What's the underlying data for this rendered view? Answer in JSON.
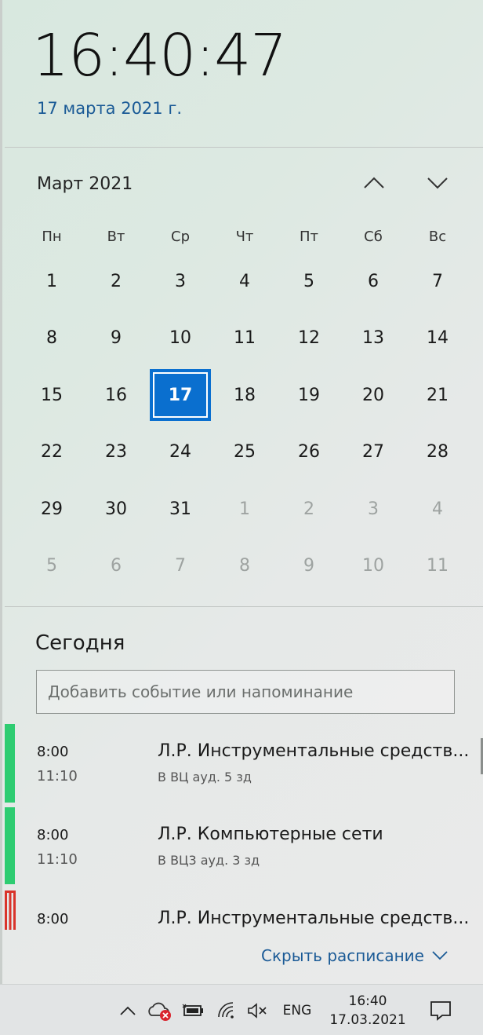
{
  "clock": {
    "time": "16:40:47",
    "date": "17 марта 2021 г."
  },
  "calendar": {
    "month_title": "Март 2021",
    "weekdays": [
      "Пн",
      "Вт",
      "Ср",
      "Чт",
      "Пт",
      "Сб",
      "Вс"
    ],
    "days": [
      {
        "d": "1"
      },
      {
        "d": "2"
      },
      {
        "d": "3"
      },
      {
        "d": "4"
      },
      {
        "d": "5"
      },
      {
        "d": "6"
      },
      {
        "d": "7"
      },
      {
        "d": "8"
      },
      {
        "d": "9"
      },
      {
        "d": "10"
      },
      {
        "d": "11"
      },
      {
        "d": "12"
      },
      {
        "d": "13"
      },
      {
        "d": "14"
      },
      {
        "d": "15"
      },
      {
        "d": "16"
      },
      {
        "d": "17",
        "today": true
      },
      {
        "d": "18"
      },
      {
        "d": "19"
      },
      {
        "d": "20"
      },
      {
        "d": "21"
      },
      {
        "d": "22"
      },
      {
        "d": "23"
      },
      {
        "d": "24"
      },
      {
        "d": "25"
      },
      {
        "d": "26"
      },
      {
        "d": "27"
      },
      {
        "d": "28"
      },
      {
        "d": "29"
      },
      {
        "d": "30"
      },
      {
        "d": "31"
      },
      {
        "d": "1",
        "other": true
      },
      {
        "d": "2",
        "other": true
      },
      {
        "d": "3",
        "other": true
      },
      {
        "d": "4",
        "other": true
      },
      {
        "d": "5",
        "other": true
      },
      {
        "d": "6",
        "other": true
      },
      {
        "d": "7",
        "other": true
      },
      {
        "d": "8",
        "other": true
      },
      {
        "d": "9",
        "other": true
      },
      {
        "d": "10",
        "other": true
      },
      {
        "d": "11",
        "other": true
      }
    ],
    "prev_icon": "chevron-up-icon",
    "next_icon": "chevron-down-icon"
  },
  "agenda": {
    "title": "Сегодня",
    "add_placeholder": "Добавить событие или напоминание",
    "events": [
      {
        "start": "8:00",
        "end": "11:10",
        "title": "Л.Р. Инструментальные средств...",
        "location": "В ВЦ ауд. 5 зд",
        "color": "#2ecc71"
      },
      {
        "start": "8:00",
        "end": "11:10",
        "title": "Л.Р. Компьютерные сети",
        "location": "В ВЦ3 ауд. 3 зд",
        "color": "#2ecc71"
      },
      {
        "start": "8:00",
        "end": "",
        "title": "Л.Р. Инструментальные средств...",
        "location": "",
        "color": "#d9342b"
      }
    ],
    "hide_label": "Скрыть расписание"
  },
  "taskbar": {
    "lang": "ENG",
    "time": "16:40",
    "date": "17.03.2021",
    "icons": [
      "chevron-up-icon",
      "onedrive-error-icon",
      "battery-icon",
      "wifi-icon",
      "volume-muted-icon",
      "notifications-icon"
    ]
  }
}
